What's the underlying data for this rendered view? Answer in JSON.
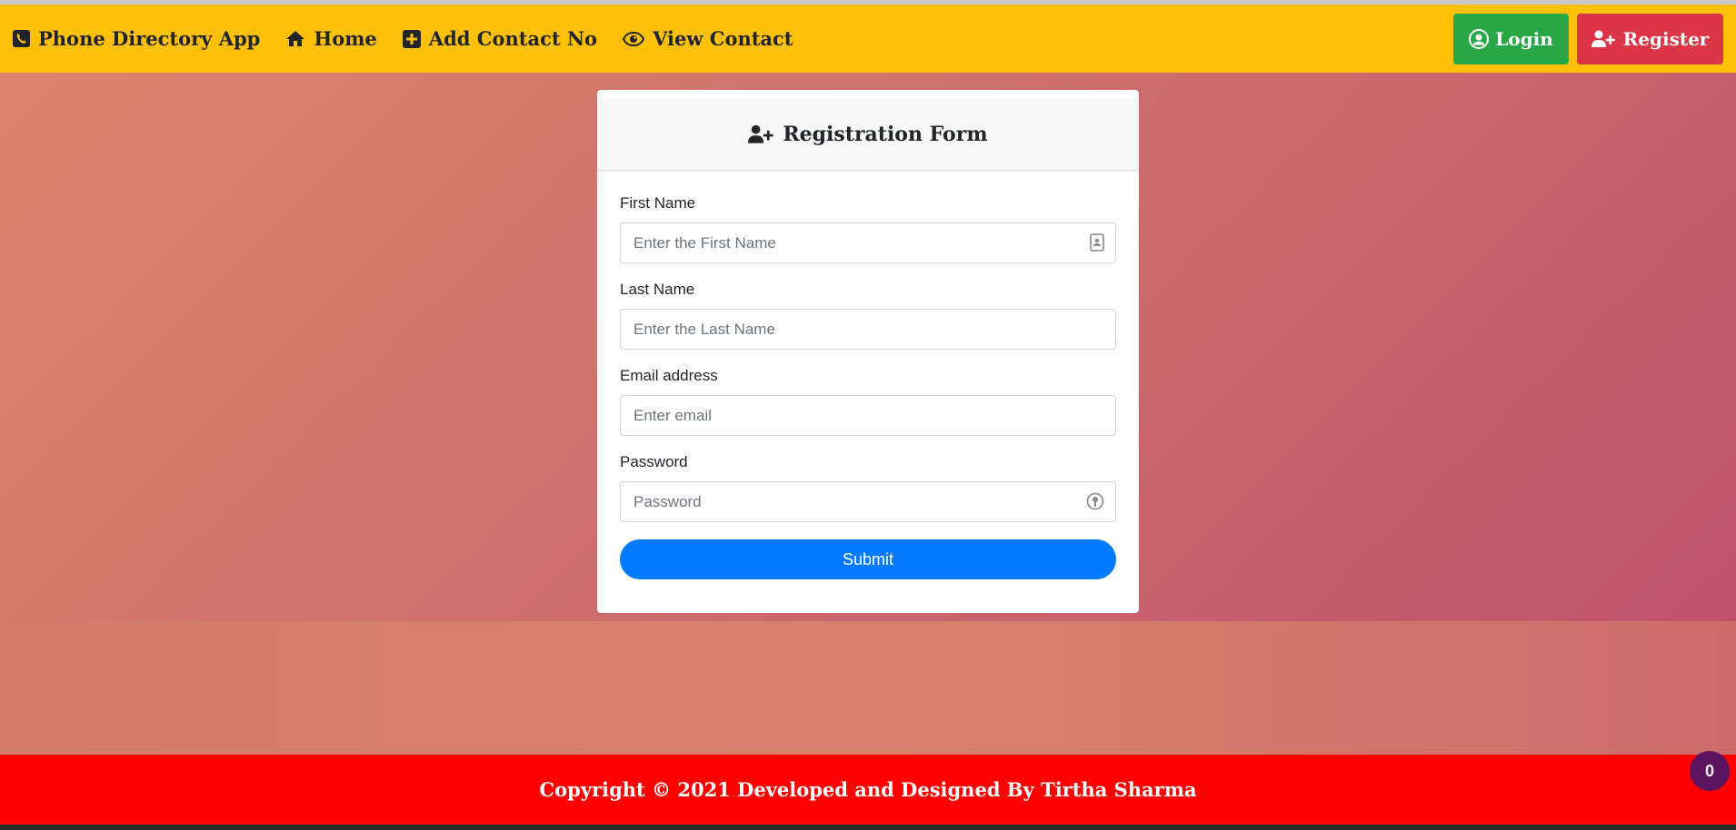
{
  "navbar": {
    "brand": "Phone Directory App",
    "links": [
      {
        "label": "Home",
        "icon": "home-icon"
      },
      {
        "label": "Add Contact No",
        "icon": "plus-square-icon"
      },
      {
        "label": "View Contact",
        "icon": "eye-icon"
      }
    ],
    "login_label": "Login",
    "register_label": "Register"
  },
  "form": {
    "title": "Registration Form",
    "first_name_label": "First Name",
    "first_name_placeholder": "Enter the First Name",
    "last_name_label": "Last Name",
    "last_name_placeholder": "Enter the Last Name",
    "email_label": "Email address",
    "email_placeholder": "Enter email",
    "password_label": "Password",
    "password_placeholder": "Password",
    "submit_label": "Submit"
  },
  "footer": {
    "text": "Copyright © 2021 Developed and Designed By Tirtha Sharma"
  },
  "badge": {
    "count": "0"
  },
  "colors": {
    "navbar": "#ffc107",
    "login": "#28a745",
    "register": "#dc3545",
    "submit": "#007bff",
    "footer": "#ff0000",
    "badge": "#5c1360"
  }
}
